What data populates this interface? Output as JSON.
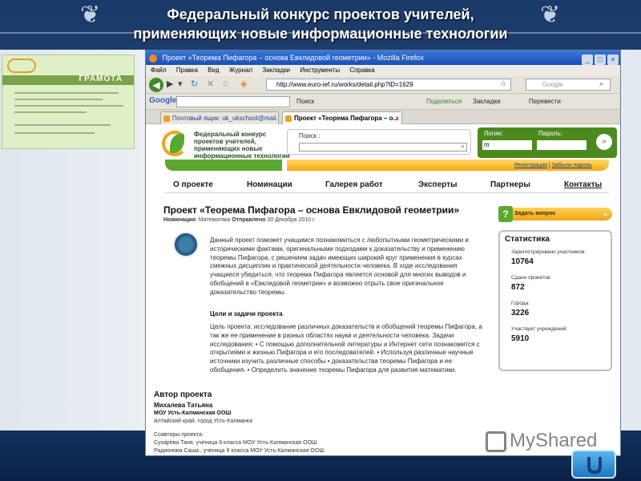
{
  "slide": {
    "title_line1": "Федеральный конкурс проектов учителей,",
    "title_line2": "применяющих новые информационные технологии"
  },
  "certificate": {
    "heading": "ГРАМОТА"
  },
  "browser": {
    "window_title": "Проект «Теорема Пифагора – основа Евклидовой геометрии» - Mozilla Firefox",
    "menu": [
      "Файл",
      "Правка",
      "Вид",
      "Журнал",
      "Закладки",
      "Инструменты",
      "Справка"
    ],
    "url": "http://www.euro-ief.ru/works/detail.php?ID=1629",
    "search_placeholder": "Google",
    "google_toolbar": {
      "logo": "Google",
      "search": "Поиск",
      "share": "Поделиться",
      "bookmarks": "Закладки",
      "translate": "Перевести"
    },
    "tabs": [
      {
        "label": "Почтовый ящик: uk_ukschool@mail.ru"
      },
      {
        "label": "Проект «Теорема Пифагора – о..."
      }
    ]
  },
  "site": {
    "logo_text": "Федеральный конкурс проектов учителей, применяющих новые информационные технологии в учебной работе",
    "search_label": "Поиск :",
    "login_label": "Логин:",
    "login_value": "m",
    "password_label": "Пароль:",
    "register_link": "Регистрация",
    "forgot_link": "Забыли пароль",
    "nav": [
      "О проекте",
      "Номинации",
      "Галерея работ",
      "Эксперты",
      "Партнеры",
      "Контакты"
    ]
  },
  "project": {
    "title": "Проект «Теорема Пифагора – основа Евклидовой геометрии»",
    "nomination_label": "Номинация:",
    "nomination": "Математика",
    "sent_label": "Отправлено",
    "sent_date": "30 Декабря 2010 г.",
    "description": "Данный проект поможет учащимся познакомиться с любопытными геометрическими и историческими фактами, оригинальными подходами к доказательству и применению теоремы Пифагора, с решением задач имеющих широкий круг применения в курсах смежных дисциплин и практической деятельности человека. В ходе исследования учащиеся убедиться, что теорема Пифагора является основой для многих выводов и обобщений в «Евклидовой геометрии» и возможно отрыть свое оригинальное доказательство теоремы.",
    "goals_heading": "Цели и задачи проекта",
    "goals_text": "Цель проекта: исследование различных доказательств и обобщений теоремы Пифагора, а так же ее применение в разных областях науки и деятельности человека. Задачи исследования: • С помощью дополнительной литературы и Интернет сети познакомится с открытиями и жизнью Пифагора и его последователей. • Используя различные научные источники изучить различные способы • доказательства теоремы Пифагора и ее обобщения. • Определить значение теоремы Пифагора для развития математики.",
    "author_heading": "Автор проекта",
    "author_name": "Михалева Татьяна",
    "author_school": "МОУ Усть-Калманская ООШ",
    "author_region": "Алтайский край, город Усть-Калманка",
    "coauthors_label": "Соавторы проекта:",
    "coauthors": [
      "Сухарева Таня, ученица 9 класса МОУ Усть-Калманская ООШ",
      "Радионова Саша , ученица 9 класса МОУ Усть-Калманская ООШ"
    ]
  },
  "sidebar": {
    "ask_button": "Задать вопрос",
    "stats_heading": "Статистика",
    "stats": [
      {
        "label": "Зарегистрировано участников:",
        "value": "10764"
      },
      {
        "label": "Сдано проектов:",
        "value": "872"
      },
      {
        "label": "Города:",
        "value": "3226"
      },
      {
        "label": "Участвует учреждений:",
        "value": "5910"
      }
    ]
  },
  "watermark": "MyShared",
  "colors": {
    "accent_green": "#5aa832",
    "accent_orange": "#f6aa14",
    "slide_blue": "#1a3a68"
  }
}
